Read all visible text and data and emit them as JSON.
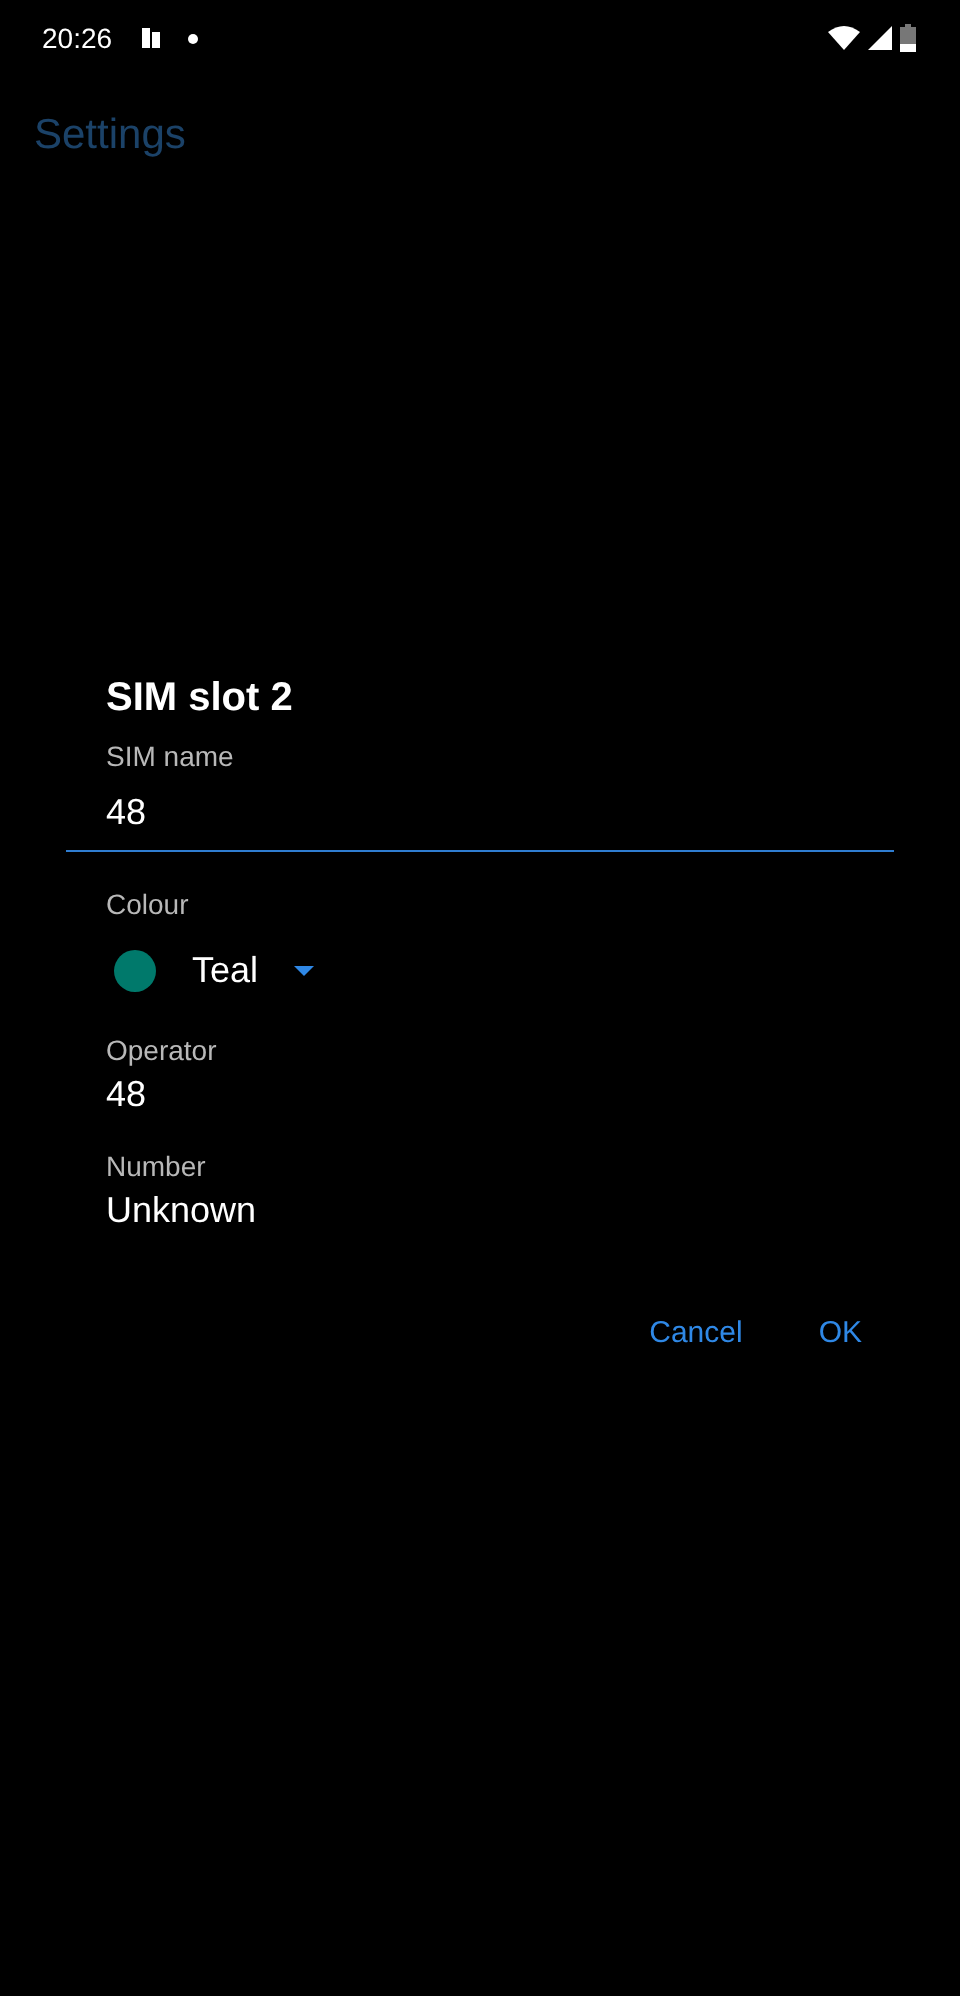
{
  "status_bar": {
    "time": "20:26"
  },
  "app_bar": {
    "title": "Settings"
  },
  "dialog": {
    "title": "SIM slot 2",
    "sim_name": {
      "label": "SIM name",
      "value": "48"
    },
    "colour": {
      "label": "Colour",
      "value": "Teal",
      "color": "#00796b"
    },
    "details": [
      {
        "label": "Operator",
        "value": "48"
      },
      {
        "label": "Number",
        "value": "Unknown"
      }
    ],
    "buttons": [
      "Cancel",
      "OK"
    ]
  }
}
